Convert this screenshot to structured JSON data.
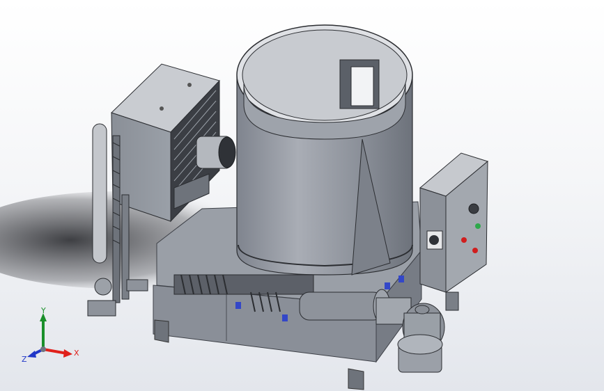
{
  "viewport": {
    "background_top": "#ffffff",
    "background_bottom": "#e3e6ec",
    "model_color": "#8e939c",
    "model_shadow_color": "#5d626b"
  },
  "triad": {
    "x_label": "X",
    "y_label": "Y",
    "z_label": "Z",
    "x_color": "#e0201b",
    "y_color": "#1a8f2a",
    "z_color": "#2137c8"
  },
  "control_panel": {
    "green_button_color": "#2ea84a",
    "red_button_color": "#d01e1e"
  }
}
